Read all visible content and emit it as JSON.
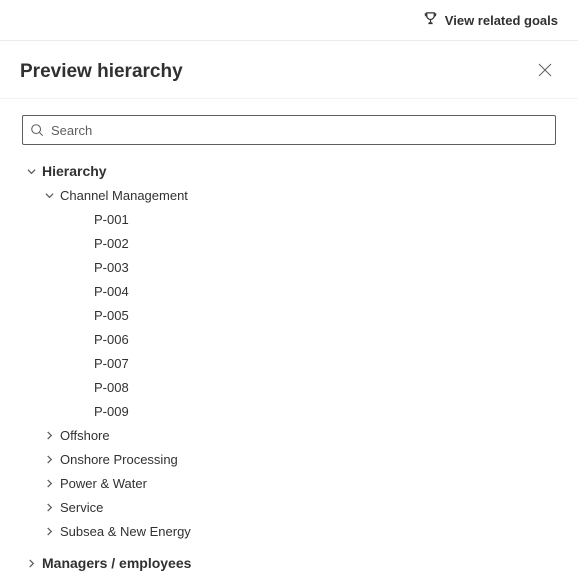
{
  "topbar": {
    "related_goals_label": "View related goals"
  },
  "panel": {
    "title": "Preview hierarchy",
    "search_placeholder": "Search"
  },
  "tree": [
    {
      "label": "Hierarchy",
      "expanded": true,
      "children": [
        {
          "label": "Channel Management",
          "expanded": true,
          "children": [
            {
              "label": "P-001"
            },
            {
              "label": "P-002"
            },
            {
              "label": "P-003"
            },
            {
              "label": "P-004"
            },
            {
              "label": "P-005"
            },
            {
              "label": "P-006"
            },
            {
              "label": "P-007"
            },
            {
              "label": "P-008"
            },
            {
              "label": "P-009"
            }
          ]
        },
        {
          "label": "Offshore",
          "expanded": false,
          "children": []
        },
        {
          "label": "Onshore Processing",
          "expanded": false,
          "children": []
        },
        {
          "label": "Power & Water",
          "expanded": false,
          "children": []
        },
        {
          "label": "Service",
          "expanded": false,
          "children": []
        },
        {
          "label": "Subsea & New Energy",
          "expanded": false,
          "children": []
        }
      ]
    },
    {
      "label": "Managers / employees",
      "expanded": false,
      "children": []
    }
  ]
}
